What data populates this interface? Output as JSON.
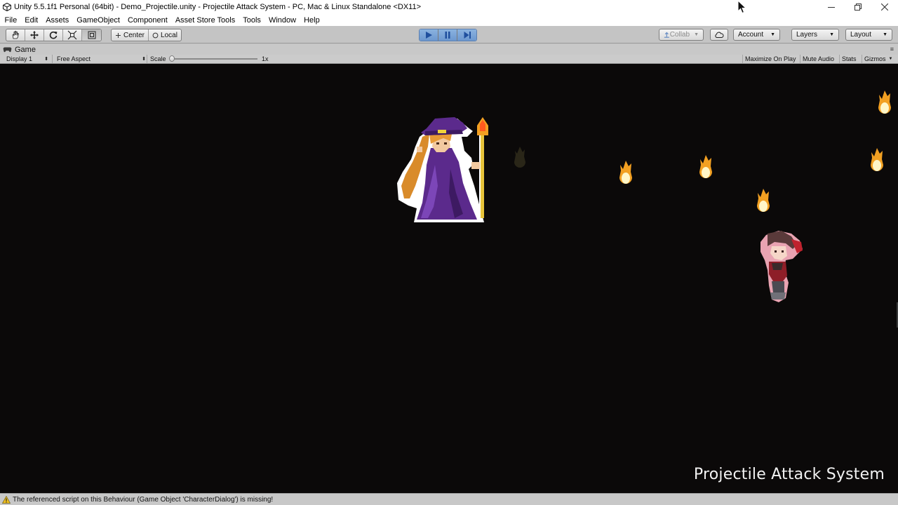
{
  "window": {
    "title": "Unity 5.5.1f1 Personal (64bit) - Demo_Projectile.unity - Projectile Attack System - PC, Mac & Linux Standalone <DX11>",
    "controls": [
      "minimize",
      "restore",
      "close"
    ]
  },
  "menu": {
    "items": [
      "File",
      "Edit",
      "Assets",
      "GameObject",
      "Component",
      "Asset Store Tools",
      "Tools",
      "Window",
      "Help"
    ]
  },
  "toolbar": {
    "transform_tools": [
      "hand-tool-icon",
      "move-tool-icon",
      "rotate-tool-icon",
      "scale-tool-icon",
      "rect-tool-icon"
    ],
    "active_tool": "rect-tool-icon",
    "pivot_label": "Center",
    "space_label": "Local",
    "play_state": "playing",
    "collab_label": "Collab",
    "account_label": "Account",
    "layers_label": "Layers",
    "layout_label": "Layout"
  },
  "game_tab": {
    "label": "Game"
  },
  "game_toolbar": {
    "display_label": "Display 1",
    "aspect_label": "Free Aspect",
    "scale_label": "Scale",
    "scale_value": "1x",
    "toggles": [
      "Maximize On Play",
      "Mute Audio",
      "Stats",
      "Gizmos"
    ]
  },
  "game": {
    "watermark": "Projectile Attack System",
    "background": "#0b0909"
  },
  "status": {
    "message": "The referenced script on this Behaviour (Game Object 'CharacterDialog') is missing!",
    "icon": "warning-icon"
  },
  "colors": {
    "play_active": "#6c98cf",
    "wizard_robe": "#5b2a8c",
    "wizard_hair": "#d98b2a",
    "fire_core": "#fff6c8",
    "fire_outer": "#f2a022"
  }
}
